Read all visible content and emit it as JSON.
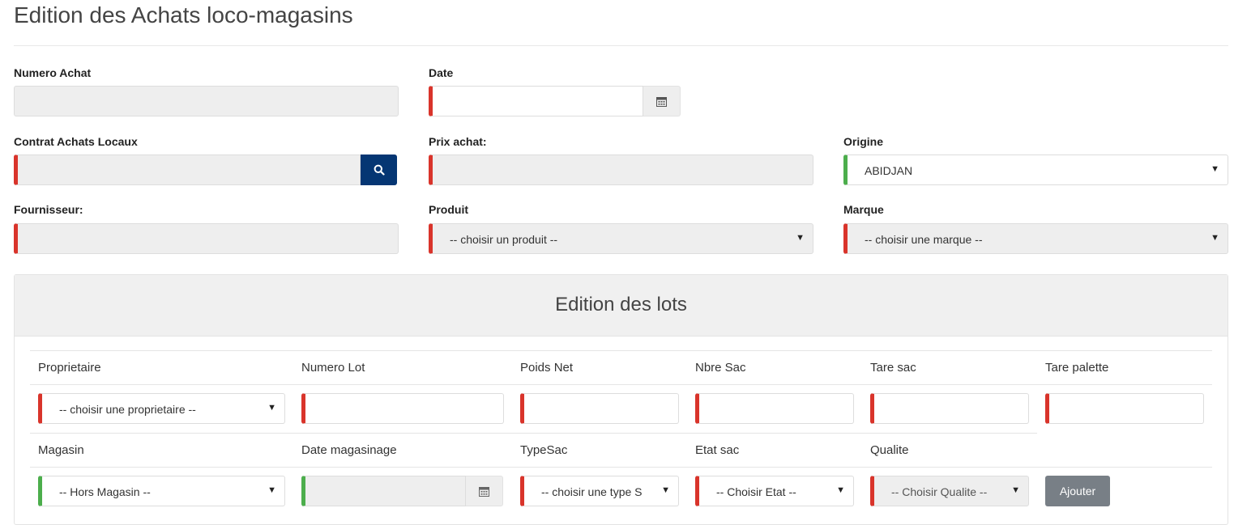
{
  "page": {
    "title": "Edition des Achats loco-magasins"
  },
  "form": {
    "numero_achat": {
      "label": "Numero Achat",
      "value": ""
    },
    "date": {
      "label": "Date",
      "value": ""
    },
    "contrat": {
      "label": "Contrat Achats Locaux",
      "value": ""
    },
    "prix_achat": {
      "label": "Prix achat:",
      "value": ""
    },
    "origine": {
      "label": "Origine",
      "value": "ABIDJAN"
    },
    "fournisseur": {
      "label": "Fournisseur:",
      "value": ""
    },
    "produit": {
      "label": "Produit",
      "value": "-- choisir un produit --"
    },
    "marque": {
      "label": "Marque",
      "value": "-- choisir une marque --"
    }
  },
  "lots": {
    "title": "Edition des lots",
    "headers1": [
      "Proprietaire",
      "Numero Lot",
      "Poids Net",
      "Nbre Sac",
      "Tare sac",
      "Tare palette"
    ],
    "row1": {
      "proprietaire": "-- choisir une proprietaire --",
      "numero_lot": "",
      "poids_net": "",
      "nbre_sac": "",
      "tare_sac": "",
      "tare_palette": ""
    },
    "headers2": [
      "Magasin",
      "Date magasinage",
      "TypeSac",
      "Etat sac",
      "Qualite"
    ],
    "row2": {
      "magasin": "-- Hors Magasin --",
      "date_magasinage": "",
      "type_sac": "-- choisir une type S",
      "etat_sac": "-- Choisir Etat --",
      "qualite": "-- Choisir Qualite --"
    },
    "add_label": "Ajouter"
  },
  "icons": {
    "calendar": "calendar-icon",
    "search": "search-icon",
    "caret": "caret-down-icon"
  },
  "colors": {
    "required": "#d9342b",
    "valid": "#4cae4c",
    "search_button": "#053673",
    "add_button": "#787f86"
  }
}
